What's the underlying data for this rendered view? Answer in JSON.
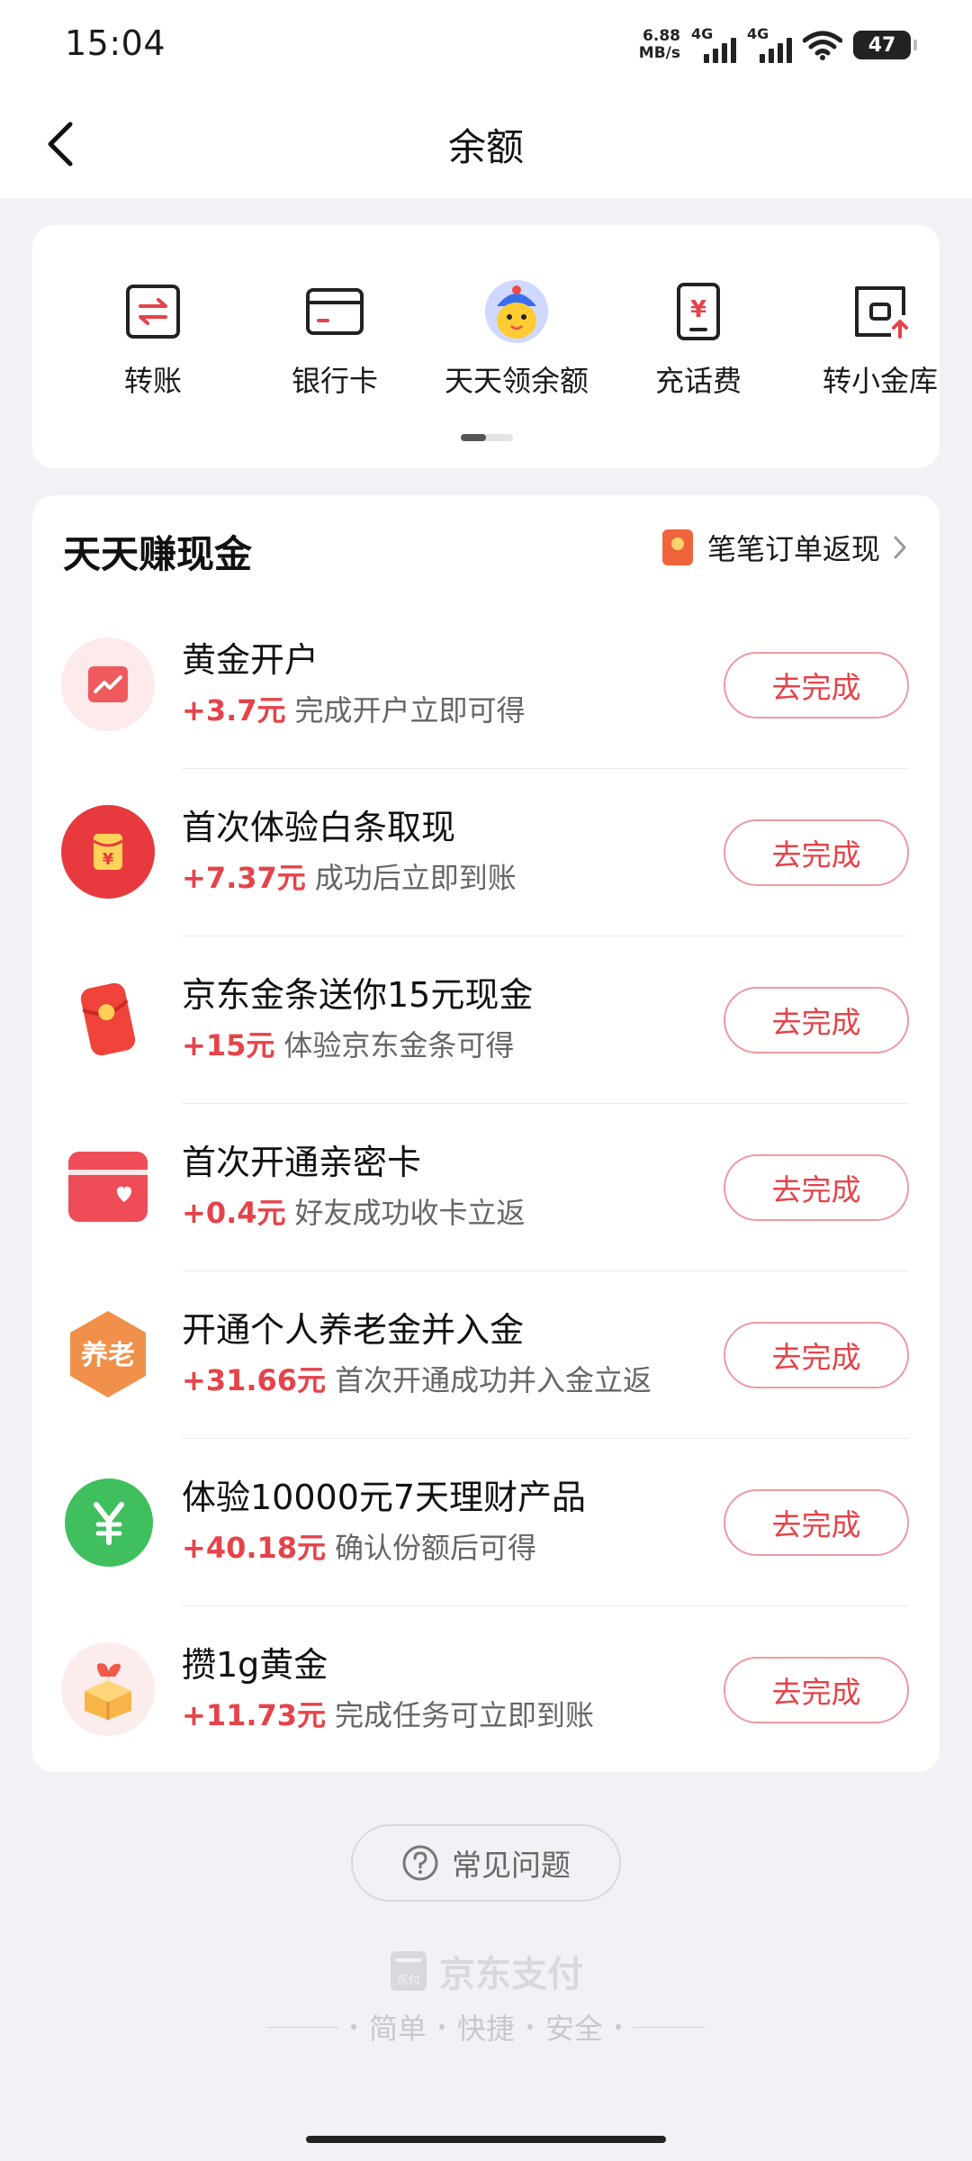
{
  "status_bar": {
    "time": "15:04",
    "net_speed_value": "6.88",
    "net_speed_unit": "MB/s",
    "signal_1_label": "4G",
    "signal_2_label": "4G",
    "battery": "47"
  },
  "header": {
    "title": "余额"
  },
  "quick_actions": [
    {
      "label": "转账",
      "icon": "transfer-icon"
    },
    {
      "label": "银行卡",
      "icon": "bank-card-icon"
    },
    {
      "label": "天天领余额",
      "icon": "mascot-icon"
    },
    {
      "label": "充话费",
      "icon": "phone-recharge-icon"
    },
    {
      "label": "转小金库",
      "icon": "vault-transfer-icon"
    }
  ],
  "tasks_section": {
    "title": "天天赚现金",
    "cashback_label": "笔笔订单返现",
    "tasks": [
      {
        "title": "黄金开户",
        "reward": "+3.7元",
        "desc": "完成开户立即可得",
        "button": "去完成",
        "icon": "gold-chart-icon"
      },
      {
        "title": "首次体验白条取现",
        "reward": "+7.37元",
        "desc": "成功后立即到账",
        "button": "去完成",
        "icon": "red-envelope-icon"
      },
      {
        "title": "京东金条送你15元现金",
        "reward": "+15元",
        "desc": "体验京东金条可得",
        "button": "去完成",
        "icon": "gold-bar-envelope-icon"
      },
      {
        "title": "首次开通亲密卡",
        "reward": "+0.4元",
        "desc": "好友成功收卡立返",
        "button": "去完成",
        "icon": "heart-card-icon"
      },
      {
        "title": "开通个人养老金并入金",
        "reward": "+31.66元",
        "desc": "首次开通成功并入金立返",
        "button": "去完成",
        "icon": "pension-icon",
        "icon_text": "养老"
      },
      {
        "title": "体验10000元7天理财产品",
        "reward": "+40.18元",
        "desc": "确认份额后可得",
        "button": "去完成",
        "icon": "yen-icon"
      },
      {
        "title": "攒1g黄金",
        "reward": "+11.73元",
        "desc": "完成任务可立即到账",
        "button": "去完成",
        "icon": "gift-box-icon"
      }
    ]
  },
  "faq": {
    "label": "常见问题"
  },
  "footer": {
    "logo_text": "东付",
    "brand": "京东支付",
    "slogan": [
      "简单",
      "快捷",
      "安全"
    ]
  },
  "colors": {
    "accent_red": "#e5434a",
    "page_bg": "#f1f1f6"
  }
}
